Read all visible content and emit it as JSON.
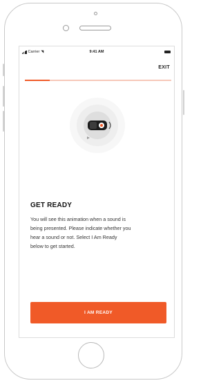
{
  "status_bar": {
    "carrier": "Carrier",
    "time": "9:41 AM",
    "icons": [
      "signal-icon",
      "wifi-icon",
      "battery-icon"
    ]
  },
  "header": {
    "exit_label": "EXIT"
  },
  "progress": {
    "fraction": 0.17,
    "color_fill": "#f05a28",
    "color_track": "#f6c7b8"
  },
  "main": {
    "animation_icon": "sound-animation-icon",
    "heading": "GET READY",
    "body_lines": [
      "You will see this animation when a sound is",
      "being presented. Please indicate whether you",
      "hear a sound or not. Select I Am Ready",
      "below to get started."
    ]
  },
  "footer": {
    "ready_button_label": "I AM READY",
    "accent_color": "#f05a28"
  }
}
